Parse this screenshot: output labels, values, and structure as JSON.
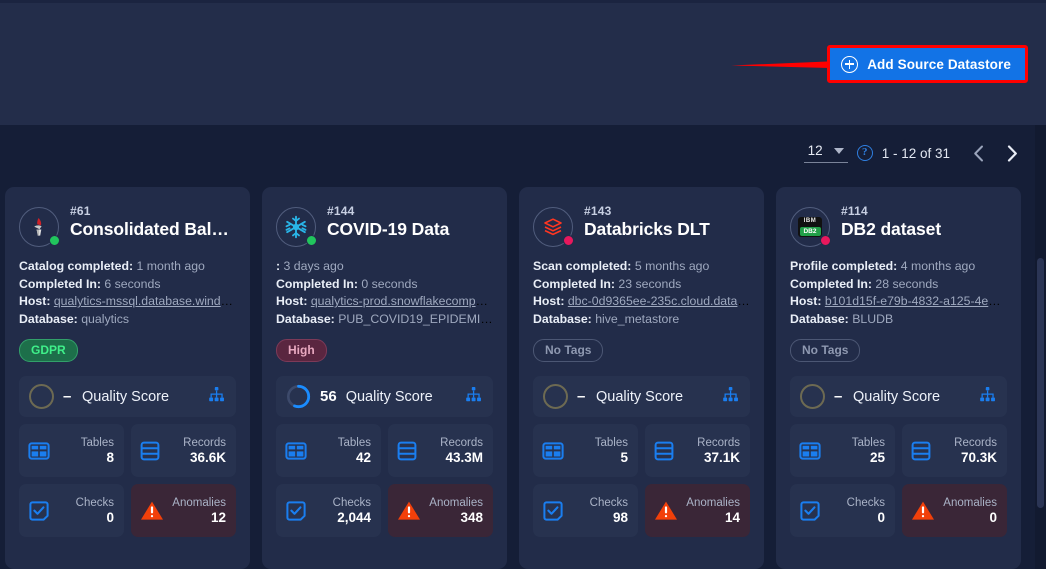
{
  "header": {
    "add_button_label": "Add Source Datastore",
    "add_button_icon": "plus-circle-icon",
    "highlight_color": "#ff0000",
    "accent_color": "#1273e6"
  },
  "annotation": {
    "type": "arrow",
    "color": "#ff0000",
    "points_to": "Add Source Datastore"
  },
  "pagination": {
    "page_size": "12",
    "page_size_caret_icon": "chevron-down-icon",
    "help_icon": "question-mark-icon",
    "help_label": "?",
    "range_label": "1 - 12 of 31",
    "prev_icon": "chevron-left-icon",
    "prev_label": "‹",
    "next_icon": "chevron-right-icon",
    "next_label": "›"
  },
  "cards": [
    {
      "id": "#61",
      "title": "Consolidated Bala…",
      "source_icon": "mssql-icon",
      "status": "green",
      "meta": [
        {
          "key": "Catalog completed:",
          "value": "1 month ago",
          "link": false
        },
        {
          "key": "Completed In:",
          "value": "6 seconds",
          "link": false
        },
        {
          "key": "Host:",
          "value": "qualytics-mssql.database.window…",
          "link": true
        },
        {
          "key": "Database:",
          "value": "qualytics",
          "link": false
        }
      ],
      "tag": {
        "label": "GDPR",
        "style": "gdpr"
      },
      "quality": {
        "value": "–",
        "percent": 0,
        "label": "Quality Score",
        "lineage_icon": "lineage-icon"
      },
      "tiles": [
        {
          "label": "Tables",
          "value": "8",
          "icon": "tables-icon",
          "danger": false
        },
        {
          "label": "Records",
          "value": "36.6K",
          "icon": "records-icon",
          "danger": false
        },
        {
          "label": "Checks",
          "value": "0",
          "icon": "checks-icon",
          "danger": false
        },
        {
          "label": "Anomalies",
          "value": "12",
          "icon": "anomalies-warning-icon",
          "danger": true
        }
      ]
    },
    {
      "id": "#144",
      "title": "COVID-19 Data",
      "source_icon": "snowflake-icon",
      "status": "green",
      "meta": [
        {
          "key": ":",
          "value": "3 days ago",
          "link": false
        },
        {
          "key": "Completed In:",
          "value": "0 seconds",
          "link": false
        },
        {
          "key": "Host:",
          "value": "qualytics-prod.snowflakecomputi…",
          "link": true
        },
        {
          "key": "Database:",
          "value": "PUB_COVID19_EPIDEMIOLO…",
          "link": false
        }
      ],
      "tag": {
        "label": "High",
        "style": "high"
      },
      "quality": {
        "value": "56",
        "percent": 56,
        "label": "Quality Score",
        "lineage_icon": "lineage-icon"
      },
      "tiles": [
        {
          "label": "Tables",
          "value": "42",
          "icon": "tables-icon",
          "danger": false
        },
        {
          "label": "Records",
          "value": "43.3M",
          "icon": "records-icon",
          "danger": false
        },
        {
          "label": "Checks",
          "value": "2,044",
          "icon": "checks-icon",
          "danger": false
        },
        {
          "label": "Anomalies",
          "value": "348",
          "icon": "anomalies-warning-icon",
          "danger": true
        }
      ]
    },
    {
      "id": "#143",
      "title": "Databricks DLT",
      "source_icon": "databricks-icon",
      "status": "red",
      "meta": [
        {
          "key": "Scan completed:",
          "value": "5 months ago",
          "link": false
        },
        {
          "key": "Completed In:",
          "value": "23 seconds",
          "link": false
        },
        {
          "key": "Host:",
          "value": "dbc-0d9365ee-235c.cloud.databr…",
          "link": true
        },
        {
          "key": "Database:",
          "value": "hive_metastore",
          "link": false
        }
      ],
      "tag": {
        "label": "No Tags",
        "style": "none"
      },
      "quality": {
        "value": "–",
        "percent": 0,
        "label": "Quality Score",
        "lineage_icon": "lineage-icon"
      },
      "tiles": [
        {
          "label": "Tables",
          "value": "5",
          "icon": "tables-icon",
          "danger": false
        },
        {
          "label": "Records",
          "value": "37.1K",
          "icon": "records-icon",
          "danger": false
        },
        {
          "label": "Checks",
          "value": "98",
          "icon": "checks-icon",
          "danger": false
        },
        {
          "label": "Anomalies",
          "value": "14",
          "icon": "anomalies-warning-icon",
          "danger": true
        }
      ]
    },
    {
      "id": "#114",
      "title": "DB2 dataset",
      "source_icon": "db2-icon",
      "status": "red",
      "meta": [
        {
          "key": "Profile completed:",
          "value": "4 months ago",
          "link": false
        },
        {
          "key": "Completed In:",
          "value": "28 seconds",
          "link": false
        },
        {
          "key": "Host:",
          "value": "b101d15f-e79b-4832-a125-4e8d4…",
          "link": true
        },
        {
          "key": "Database:",
          "value": "BLUDB",
          "link": false
        }
      ],
      "tag": {
        "label": "No Tags",
        "style": "none"
      },
      "quality": {
        "value": "–",
        "percent": 0,
        "label": "Quality Score",
        "lineage_icon": "lineage-icon"
      },
      "tiles": [
        {
          "label": "Tables",
          "value": "25",
          "icon": "tables-icon",
          "danger": false
        },
        {
          "label": "Records",
          "value": "70.3K",
          "icon": "records-icon",
          "danger": false
        },
        {
          "label": "Checks",
          "value": "0",
          "icon": "checks-icon",
          "danger": false
        },
        {
          "label": "Anomalies",
          "value": "0",
          "icon": "anomalies-warning-icon",
          "danger": true
        }
      ]
    }
  ]
}
